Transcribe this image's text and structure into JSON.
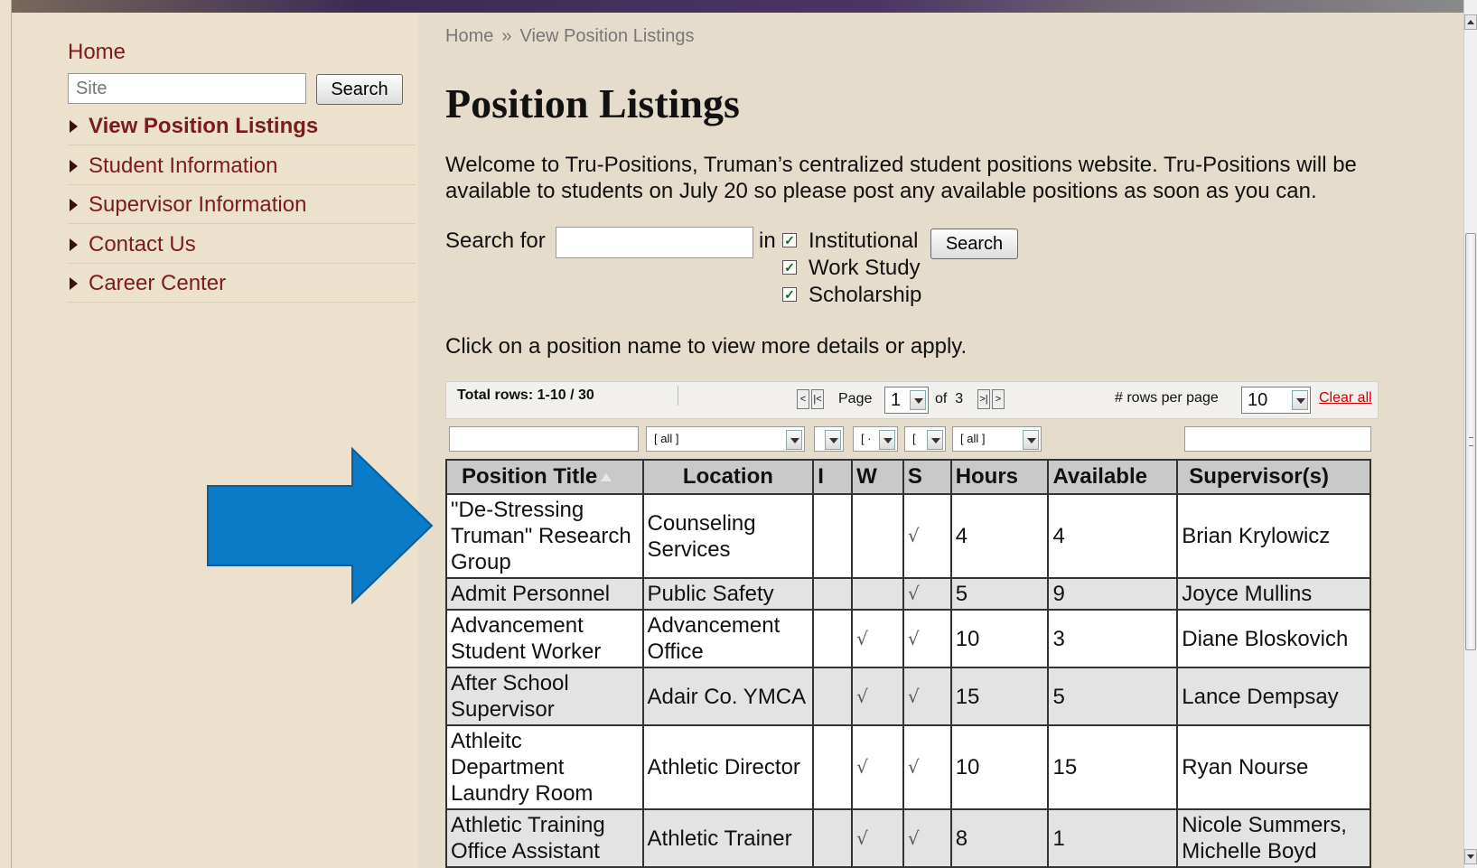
{
  "sidebar": {
    "home": "Home",
    "search_placeholder": "Site",
    "search_button": "Search",
    "items": [
      {
        "label": "View Position Listings",
        "active": true
      },
      {
        "label": "Student Information",
        "active": false
      },
      {
        "label": "Supervisor Information",
        "active": false
      },
      {
        "label": "Contact Us",
        "active": false
      },
      {
        "label": "Career Center",
        "active": false
      }
    ]
  },
  "breadcrumb": {
    "home": "Home",
    "separator": "»",
    "current": "View Position Listings"
  },
  "page_title": "Position Listings",
  "intro": "Welcome to Tru-Positions, Truman’s centralized student positions website. Tru-Positions will be available to students on July 20 so please post any available positions as soon as you can.",
  "search_form": {
    "label": "Search for",
    "in_label": "in",
    "options": [
      {
        "label": "Institutional",
        "checked": true
      },
      {
        "label": "Work Study",
        "checked": true
      },
      {
        "label": "Scholarship",
        "checked": true
      }
    ],
    "button": "Search"
  },
  "hint": "Click on a position name to view more details or apply.",
  "toolbar": {
    "total_rows": "Total rows: 1-10 / 30",
    "page_label": "Page",
    "page_value": "1",
    "of_label": "of",
    "page_count": "3",
    "rows_per_page_label": "# rows per page",
    "rows_per_page_value": "10",
    "clear_all": "Clear all",
    "first": "<",
    "prev": "|<",
    "next": ">|",
    "last": ">"
  },
  "filters": {
    "location": "[ all ]",
    "i": "",
    "w": "[ ·",
    "s": "[",
    "hours": "[ all ]"
  },
  "table": {
    "columns": [
      "Position Title",
      "Location",
      "I",
      "W",
      "S",
      "Hours",
      "Available",
      "Supervisor(s)"
    ],
    "rows": [
      {
        "title": "\"De-Stressing Truman\" Research Group",
        "location": "Counseling Services",
        "i": "",
        "w": "",
        "s": "√",
        "hours": "4",
        "available": "4",
        "supervisor": "Brian Krylowicz"
      },
      {
        "title": "Admit Personnel",
        "location": "Public Safety",
        "i": "",
        "w": "",
        "s": "√",
        "hours": "5",
        "available": "9",
        "supervisor": "Joyce Mullins"
      },
      {
        "title": "Advancement Student Worker",
        "location": "Advancement Office",
        "i": "",
        "w": "√",
        "s": "√",
        "hours": "10",
        "available": "3",
        "supervisor": "Diane Bloskovich"
      },
      {
        "title": "After School Supervisor",
        "location": "Adair Co. YMCA",
        "i": "",
        "w": "√",
        "s": "√",
        "hours": "15",
        "available": "5",
        "supervisor": "Lance Dempsay"
      },
      {
        "title": "Athleitc Department Laundry Room",
        "location": "Athletic Director",
        "i": "",
        "w": "√",
        "s": "√",
        "hours": "10",
        "available": "15",
        "supervisor": "Ryan Nourse"
      },
      {
        "title": "Athletic Training Office Assistant",
        "location": "Athletic Trainer",
        "i": "",
        "w": "√",
        "s": "√",
        "hours": "8",
        "available": "1",
        "supervisor": "Nicole Summers, Michelle Boyd"
      }
    ]
  },
  "colors": {
    "link": "#7a1c1c",
    "arrow": "#0b7bc8",
    "clear_all": "#cc0000"
  }
}
